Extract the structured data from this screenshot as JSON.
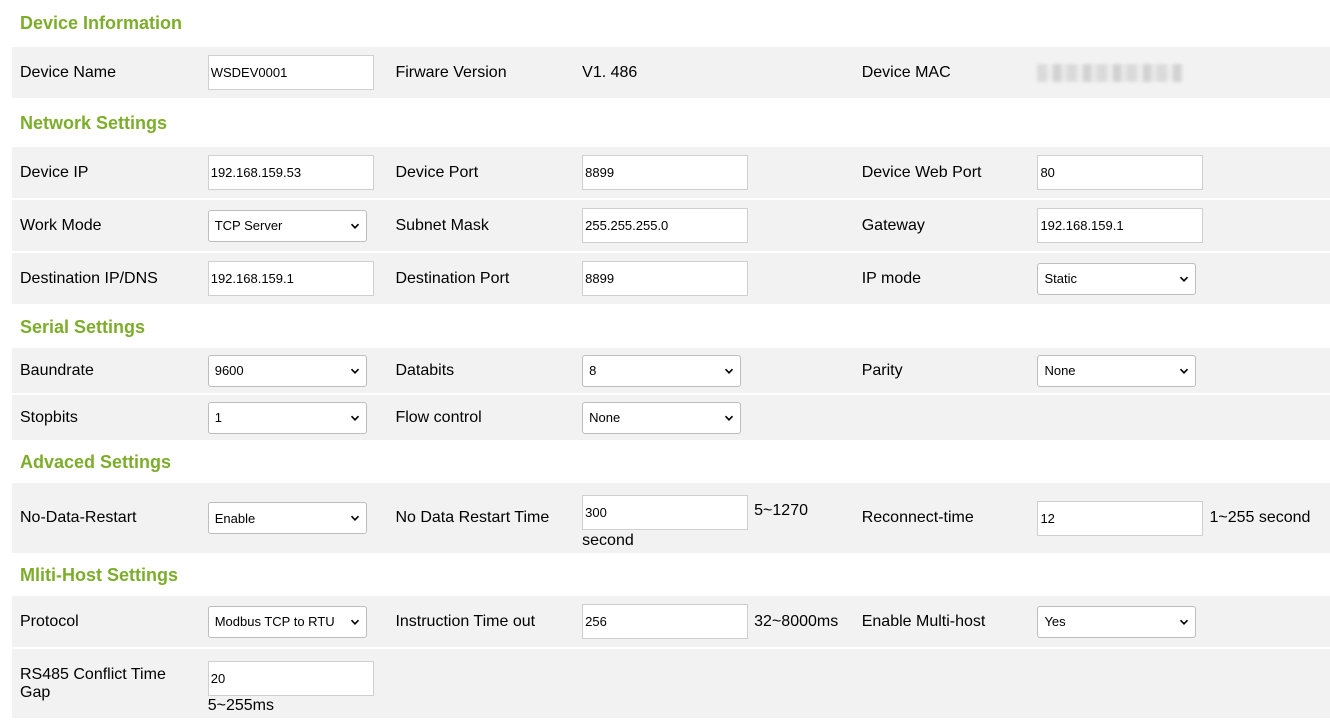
{
  "sections": {
    "device_info": "Device Information",
    "network": "Network Settings",
    "serial": "Serial Settings",
    "advanced": "Advaced Settings",
    "multihost": "Mliti-Host Settings"
  },
  "device": {
    "name_label": "Device Name",
    "name_value": "WSDEV0001",
    "fw_label": "Firware Version",
    "fw_value": "V1. 486",
    "mac_label": "Device MAC"
  },
  "network": {
    "ip_label": "Device IP",
    "ip_value": "192.168.159.53",
    "port_label": "Device Port",
    "port_value": "8899",
    "web_port_label": "Device Web Port",
    "web_port_value": "80",
    "work_mode_label": "Work Mode",
    "work_mode_value": "TCP Server",
    "subnet_label": "Subnet Mask",
    "subnet_value": "255.255.255.0",
    "gateway_label": "Gateway",
    "gateway_value": "192.168.159.1",
    "dest_ip_label": "Destination IP/DNS",
    "dest_ip_value": "192.168.159.1",
    "dest_port_label": "Destination Port",
    "dest_port_value": "8899",
    "ip_mode_label": "IP mode",
    "ip_mode_value": "Static"
  },
  "serial": {
    "baud_label": "Baundrate",
    "baud_value": "9600",
    "databits_label": "Databits",
    "databits_value": "8",
    "parity_label": "Parity",
    "parity_value": "None",
    "stopbits_label": "Stopbits",
    "stopbits_value": "1",
    "flow_label": "Flow control",
    "flow_value": "None"
  },
  "advanced": {
    "ndr_label": "No-Data-Restart",
    "ndr_value": "Enable",
    "ndr_time_label": "No Data Restart Time",
    "ndr_time_value": "300",
    "ndr_time_range": "5~1270",
    "ndr_time_unit": "second",
    "reconnect_label": "Reconnect-time",
    "reconnect_value": "12",
    "reconnect_range": "1~255 second"
  },
  "multihost": {
    "protocol_label": "Protocol",
    "protocol_value": "Modbus TCP to RTU",
    "timeout_label": "Instruction Time out",
    "timeout_value": "256",
    "timeout_range": "32~8000ms",
    "enable_label": "Enable Multi-host",
    "enable_value": "Yes",
    "rs485_label": "RS485 Conflict Time Gap",
    "rs485_value": "20",
    "rs485_range": "5~255ms"
  }
}
